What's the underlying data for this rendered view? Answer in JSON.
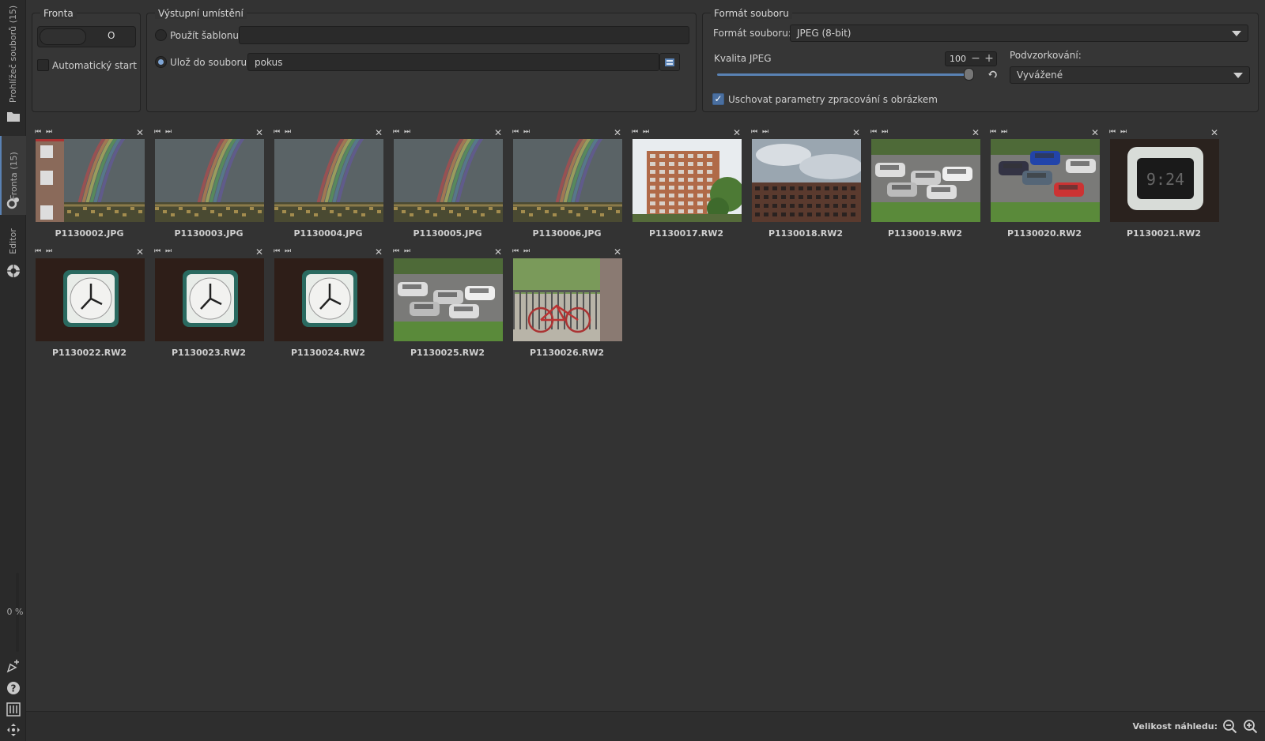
{
  "sidebar": {
    "tabs": [
      {
        "label": "Prohlížeč souborů (15)"
      },
      {
        "label": "Fronta (15)"
      },
      {
        "label": "Editor"
      }
    ],
    "progress": "0 %"
  },
  "queue": {
    "title": "Fronta",
    "switch_value": "O",
    "autostart_label": "Automatický start"
  },
  "output": {
    "title": "Výstupní umístění",
    "use_template_label": "Použít šablonu:",
    "template_value": "",
    "save_to_file_label": "Ulož do souboru:",
    "filename_value": "pokus"
  },
  "format": {
    "title": "Formát souboru",
    "format_label": "Formát souboru:",
    "format_value": "JPEG (8-bit)",
    "jpeg_quality_label": "Kvalita JPEG",
    "jpeg_quality_value": "100",
    "jpeg_quality_percent": 100,
    "subsampling_label": "Podvzorkování:",
    "subsampling_value": "Vyvážené",
    "keep_params_label": "Uschovat parametry zpracování s obrázkem"
  },
  "thumbnails": [
    {
      "name": "P1130002.JPG",
      "scene": "rainbow-building"
    },
    {
      "name": "P1130003.JPG",
      "scene": "rainbow"
    },
    {
      "name": "P1130004.JPG",
      "scene": "rainbow"
    },
    {
      "name": "P1130005.JPG",
      "scene": "rainbow"
    },
    {
      "name": "P1130006.JPG",
      "scene": "rainbow"
    },
    {
      "name": "P1130017.RW2",
      "scene": "building"
    },
    {
      "name": "P1130018.RW2",
      "scene": "sky-building"
    },
    {
      "name": "P1130019.RW2",
      "scene": "cars"
    },
    {
      "name": "P1130020.RW2",
      "scene": "cars-red"
    },
    {
      "name": "P1130021.RW2",
      "scene": "clock-digital"
    },
    {
      "name": "P1130022.RW2",
      "scene": "clock"
    },
    {
      "name": "P1130023.RW2",
      "scene": "clock"
    },
    {
      "name": "P1130024.RW2",
      "scene": "clock"
    },
    {
      "name": "P1130025.RW2",
      "scene": "cars"
    },
    {
      "name": "P1130026.RW2",
      "scene": "bike"
    }
  ],
  "bottom": {
    "zoom_label": "Velikost náhledu:"
  },
  "colors": {
    "accent": "#5a82b4",
    "background": "#333333",
    "panel": "#363636"
  }
}
